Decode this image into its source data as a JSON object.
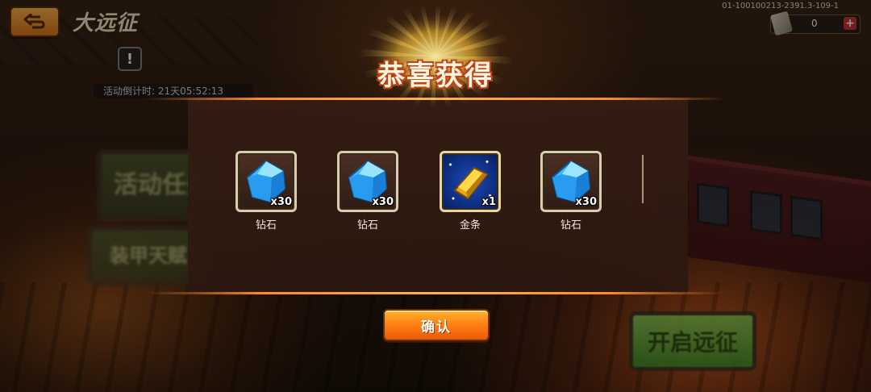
{
  "header": {
    "title": "大远征",
    "build_id": "01-100100213-2391.3-109-1",
    "countdown": "活动倒计时: 21天05:52:13",
    "alert_symbol": "!"
  },
  "currency": {
    "amount": "0",
    "plus": "+"
  },
  "background": {
    "side_button_1": "活动任务",
    "side_button_2": "装甲天赋",
    "start_button": "开启远征"
  },
  "modal": {
    "title": "恭喜获得",
    "rewards": [
      {
        "name": "钻石",
        "qty": "x30",
        "icon": "diamond-icon"
      },
      {
        "name": "钻石",
        "qty": "x30",
        "icon": "diamond-icon"
      },
      {
        "name": "金条",
        "qty": "x1",
        "icon": "gold-bar-icon"
      },
      {
        "name": "钻石",
        "qty": "x30",
        "icon": "diamond-icon"
      }
    ],
    "confirm_label": "确认"
  },
  "colors": {
    "confirm_orange": "#ff7a12",
    "title_glow": "#ffd45a",
    "diamond_blue": "#3fb8ff",
    "gold_slot_blue": "#1d4cb8"
  }
}
